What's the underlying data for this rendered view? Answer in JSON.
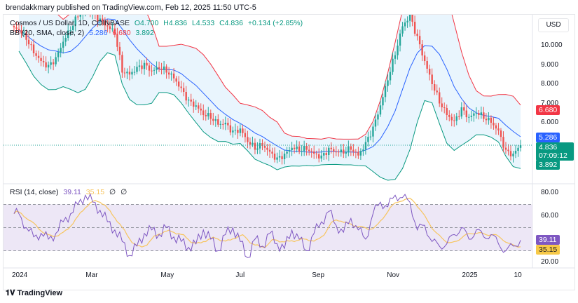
{
  "publisher_line": "brendakkmary published on TradingView.com, Feb 12, 2025 11:50 UTC-5",
  "brand": "TradingView",
  "currency_button": "USD",
  "legend": {
    "symbol": "Cosmos / US Dollar, 1D, COINBASE",
    "open": "O4.700",
    "high": "H4.836",
    "low": "L4.533",
    "close": "C4.836",
    "change": "+0.134 (+2.85%)",
    "bb_label": "BB (20, SMA, close, 2)",
    "bb_basis": "5.286",
    "bb_upper": "6.680",
    "bb_lower": "3.892",
    "rsi_label": "RSI (14, close)",
    "rsi_value": "39.11",
    "rsi_ma": "35.15",
    "rsi_extra1": "∅",
    "rsi_extra2": "∅"
  },
  "colors": {
    "up": "#26a69a",
    "down": "#ef5350",
    "basis": "#2962ff",
    "upper": "#f23645",
    "lower": "#089981",
    "rsi": "#7e57c2",
    "rsi_ma": "#f7c55f",
    "band_fill": "#e3f2fd",
    "rsi_band": "#ede7f6"
  },
  "price_tags": {
    "upper": "6.680",
    "basis": "5.286",
    "last": "4.836",
    "countdown": "07:09:12",
    "lower": "3.892"
  },
  "rsi_tags": {
    "rsi": "39.11",
    "ma": "35.15"
  },
  "chart_data": [
    {
      "type": "candlestick",
      "title": "Cosmos / US Dollar, 1D, COINBASE",
      "ylabel": "USD",
      "yticks": [
        "10.000",
        "9.000",
        "8.000",
        "7.000",
        "6.000"
      ],
      "ylim": [
        3,
        11.6
      ],
      "x_step_days": 6,
      "closes": [
        10.8,
        10.3,
        9.6,
        9.2,
        9.0,
        9.4,
        10.2,
        10.8,
        11.5,
        11.9,
        11.7,
        11.4,
        11.0,
        10.6,
        8.6,
        8.5,
        8.9,
        9.1,
        8.7,
        8.8,
        8.6,
        8.3,
        7.8,
        7.2,
        6.9,
        6.4,
        6.2,
        5.9,
        6.0,
        5.6,
        5.7,
        5.0,
        4.6,
        4.8,
        4.5,
        4.2,
        4.4,
        4.7,
        4.5,
        4.6,
        4.4,
        4.3,
        4.7,
        4.5,
        4.4,
        4.6,
        4.3,
        5.0,
        5.8,
        6.9,
        8.2,
        9.5,
        11.0,
        11.6,
        10.5,
        9.2,
        8.0,
        7.0,
        6.4,
        6.1,
        6.8,
        6.3,
        6.5,
        6.2,
        6.0,
        5.6,
        4.6,
        4.4,
        4.836
      ],
      "overlay": "Bollinger Bands (20, SMA, close, 2)"
    },
    {
      "type": "line",
      "title": "RSI (14, close)",
      "yticks": [
        "80.00",
        "60.00",
        "20.00"
      ],
      "ylim": [
        15,
        85
      ],
      "bands": [
        30,
        50,
        70
      ],
      "rsi": [
        62,
        50,
        42,
        45,
        40,
        45,
        55,
        62,
        70,
        78,
        72,
        65,
        55,
        48,
        38,
        26,
        34,
        45,
        48,
        44,
        50,
        42,
        38,
        33,
        36,
        48,
        40,
        30,
        44,
        50,
        38,
        24,
        40,
        34,
        45,
        36,
        32,
        48,
        40,
        30,
        45,
        55,
        64,
        52,
        46,
        58,
        48,
        40,
        62,
        72,
        68,
        78,
        76,
        72,
        48,
        52,
        38,
        34,
        36,
        44,
        50,
        40,
        48,
        42,
        44,
        36,
        30,
        34,
        39.11
      ]
    }
  ],
  "x_axis": {
    "labels": [
      {
        "text": "2024",
        "day": 0
      },
      {
        "text": "Mar",
        "day": 60
      },
      {
        "text": "May",
        "day": 121
      },
      {
        "text": "Jul",
        "day": 182
      },
      {
        "text": "Sep",
        "day": 244
      },
      {
        "text": "Nov",
        "day": 305
      },
      {
        "text": "2025",
        "day": 366
      },
      {
        "text": "10",
        "day": 406
      }
    ]
  }
}
